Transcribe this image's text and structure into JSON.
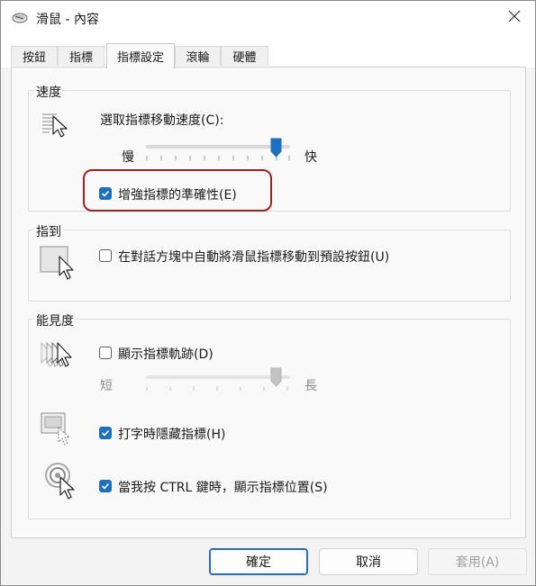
{
  "window": {
    "title": "滑鼠 - 內容"
  },
  "tabs": [
    {
      "label": "按鈕"
    },
    {
      "label": "指標"
    },
    {
      "label": "指標設定",
      "active": true
    },
    {
      "label": "滾輪"
    },
    {
      "label": "硬體"
    }
  ],
  "speed": {
    "group_title": "速度",
    "select_label": "選取指標移動速度(C):",
    "slow_label": "慢",
    "fast_label": "快",
    "slider_value_fraction": 0.9,
    "precision": {
      "label": "增強指標的準確性(E)",
      "checked": true
    }
  },
  "snap_to": {
    "group_title": "指到",
    "label": "在對話方塊中自動將滑鼠指標移動到預設按鈕(U)",
    "checked": false
  },
  "visibility": {
    "group_title": "能見度",
    "trails": {
      "label": "顯示指標軌跡(D)",
      "checked": false
    },
    "short_label": "短",
    "long_label": "長",
    "trails_slider_fraction": 0.9,
    "hide_typing": {
      "label": "打字時隱藏指標(H)",
      "checked": true
    },
    "ctrl_show": {
      "label": "當我按 CTRL 鍵時，顯示指標位置(S)",
      "checked": true
    }
  },
  "buttons": {
    "ok": "確定",
    "cancel": "取消",
    "apply": "套用(A)"
  },
  "colors": {
    "accent": "#1f6fbf",
    "highlight_border": "#a02323"
  }
}
